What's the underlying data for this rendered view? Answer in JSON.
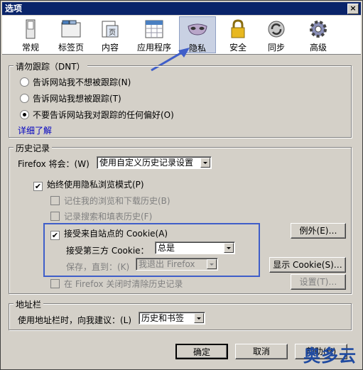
{
  "window": {
    "title": "选项",
    "close": "×"
  },
  "toolbar": {
    "items": [
      {
        "label": "常规",
        "icon": "switch-icon"
      },
      {
        "label": "标签页",
        "icon": "tabs-icon"
      },
      {
        "label": "内容",
        "icon": "document-icon"
      },
      {
        "label": "应用程序",
        "icon": "calendar-icon"
      },
      {
        "label": "隐私",
        "icon": "mask-icon",
        "selected": true
      },
      {
        "label": "安全",
        "icon": "lock-icon"
      },
      {
        "label": "同步",
        "icon": "sync-icon"
      },
      {
        "label": "高级",
        "icon": "gear-icon"
      }
    ]
  },
  "dnt": {
    "title": "请勿跟踪（DNT）",
    "opt1": "告诉网站我不想被跟踪(N)",
    "opt2": "告诉网站我想被跟踪(T)",
    "opt3": "不要告诉网站我对跟踪的任何偏好(O)",
    "more": "详细了解"
  },
  "history": {
    "title": "历史记录",
    "will_label": "Firefox 将会：(W)",
    "will_value": "使用自定义历史记录设置",
    "private": "始终使用隐私浏览模式(P)",
    "remember_browse": "记住我的浏览和下载历史(B)",
    "remember_search": "记录搜索和填表历史(F)",
    "accept_cookies": "接受来自站点的 Cookie(A)",
    "exceptions": "例外(E)…",
    "third_party_label": "接受第三方 Cookie：",
    "third_party_value": "总是",
    "keep_label": "保存，直到：(K)",
    "keep_value": "我退出 Firefox",
    "show_cookies": "显示 Cookie(S)…",
    "clear_on_close": "在 Firefox 关闭时清除历史记录",
    "settings": "设置(T)…"
  },
  "location": {
    "title": "地址栏",
    "label": "使用地址栏时，向我建议：(L)",
    "value": "历史和书签"
  },
  "footer": {
    "ok": "确定",
    "cancel": "取消",
    "help": "帮助(H)"
  },
  "watermark": "奥多云",
  "colors": {
    "highlight": "#3f5ec9",
    "title_bar": "#0a246a",
    "link": "#0000c0"
  }
}
